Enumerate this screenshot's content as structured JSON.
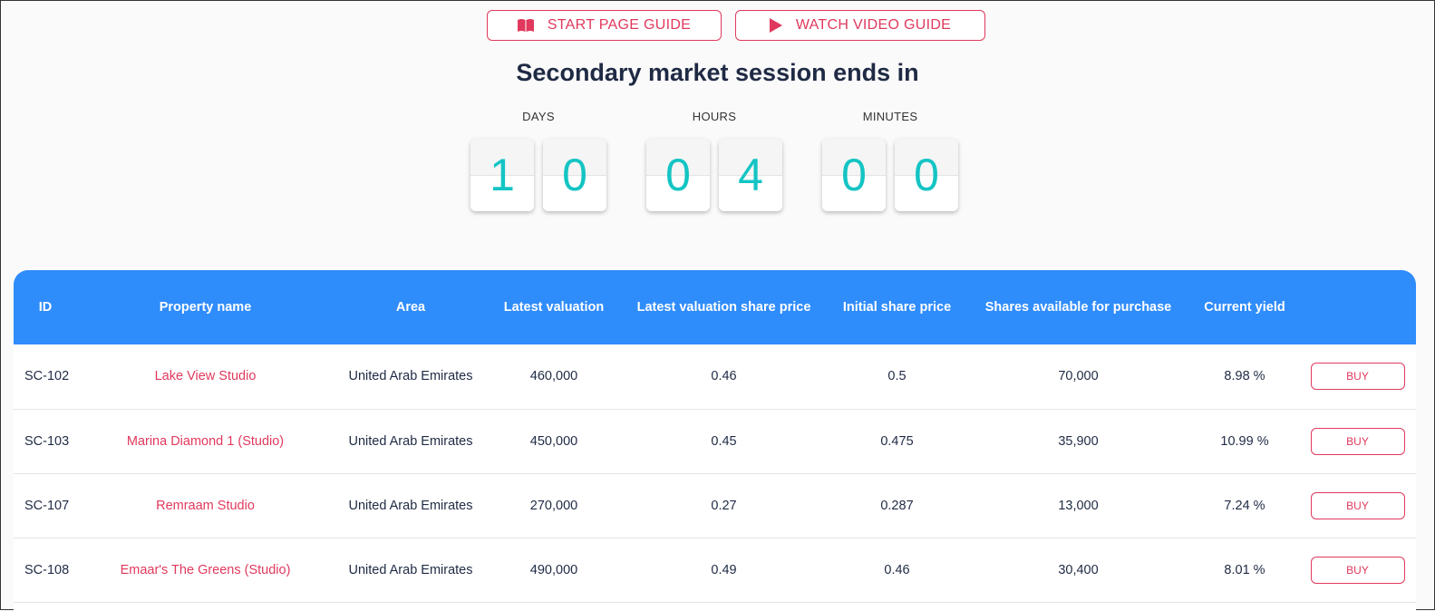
{
  "guides": {
    "start_label": "START PAGE GUIDE",
    "video_label": "WATCH VIDEO GUIDE"
  },
  "session": {
    "title": "Secondary market session ends in",
    "days_label": "DAYS",
    "hours_label": "HOURS",
    "minutes_label": "MINUTES",
    "days": [
      "1",
      "0"
    ],
    "hours": [
      "0",
      "4"
    ],
    "minutes": [
      "0",
      "0"
    ]
  },
  "table": {
    "headers": [
      "ID",
      "Property name",
      "Area",
      "Latest valuation",
      "Latest valuation share price",
      "Initial share price",
      "Shares available for purchase",
      "Current yield",
      ""
    ],
    "buy_label": "BUY",
    "rows": [
      {
        "id": "SC-102",
        "name": "Lake View Studio",
        "area": "United Arab Emirates",
        "valuation": "460,000",
        "val_share_price": "0.46",
        "initial_price": "0.5",
        "shares": "70,000",
        "yield": "8.98 %"
      },
      {
        "id": "SC-103",
        "name": "Marina Diamond 1 (Studio)",
        "area": "United Arab Emirates",
        "valuation": "450,000",
        "val_share_price": "0.45",
        "initial_price": "0.475",
        "shares": "35,900",
        "yield": "10.99 %"
      },
      {
        "id": "SC-107",
        "name": "Remraam Studio",
        "area": "United Arab Emirates",
        "valuation": "270,000",
        "val_share_price": "0.27",
        "initial_price": "0.287",
        "shares": "13,000",
        "yield": "7.24 %"
      },
      {
        "id": "SC-108",
        "name": "Emaar's The Greens (Studio)",
        "area": "United Arab Emirates",
        "valuation": "490,000",
        "val_share_price": "0.49",
        "initial_price": "0.46",
        "shares": "30,400",
        "yield": "8.01 %"
      }
    ]
  },
  "colors": {
    "accent": "#e0395d",
    "header_bg": "#2f8cfb",
    "digit": "#14c4c4"
  }
}
